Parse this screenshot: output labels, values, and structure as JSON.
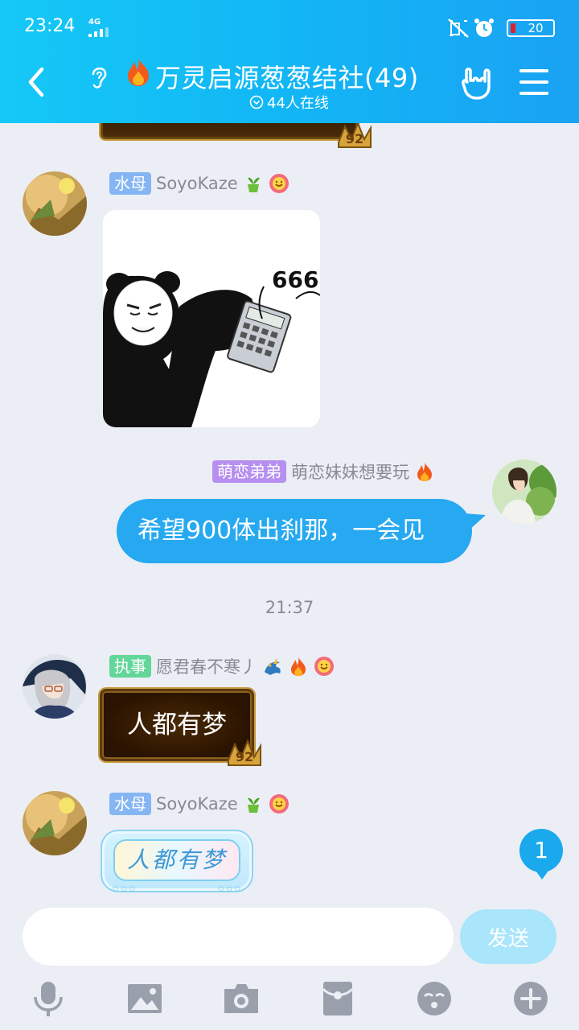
{
  "status_bar": {
    "time": "23:24",
    "network": "4G",
    "battery": "20"
  },
  "header": {
    "title": "万灵启源葱葱结社(49)",
    "online": "44人在线"
  },
  "messages": [
    {
      "tag": "水母",
      "name": "SoyoKaze",
      "sticker_text": "666"
    },
    {
      "tag": "萌恋弟弟",
      "name": "萌恋妹妹想要玩",
      "text": "希望900体出刹那，一会见"
    },
    {
      "time": "21:37"
    },
    {
      "tag": "执事",
      "name": "愿君春不寒丿",
      "text": "人都有梦"
    },
    {
      "tag": "水母",
      "name": "SoyoKaze",
      "text": "人都有梦"
    }
  ],
  "unread_count": "1",
  "input": {
    "placeholder": "",
    "send_label": "发送"
  },
  "colors": {
    "header": "#15b9f5",
    "bubble": "#27a9f1",
    "background": "#eceef5"
  }
}
